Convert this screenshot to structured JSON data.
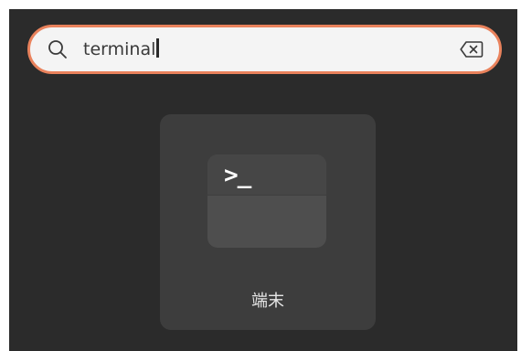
{
  "search": {
    "query": "terminal",
    "icon": "search-icon",
    "clear_icon": "backspace-clear-icon"
  },
  "results": [
    {
      "label": "端末",
      "icon": "terminal-app-icon",
      "icon_glyph": ">_"
    }
  ],
  "colors": {
    "background": "#2b2b2b",
    "search_border": "#e9825c",
    "search_fill": "#f4f4f4",
    "tile_background": "#3d3d3d",
    "text_light": "#e6e6e6"
  }
}
